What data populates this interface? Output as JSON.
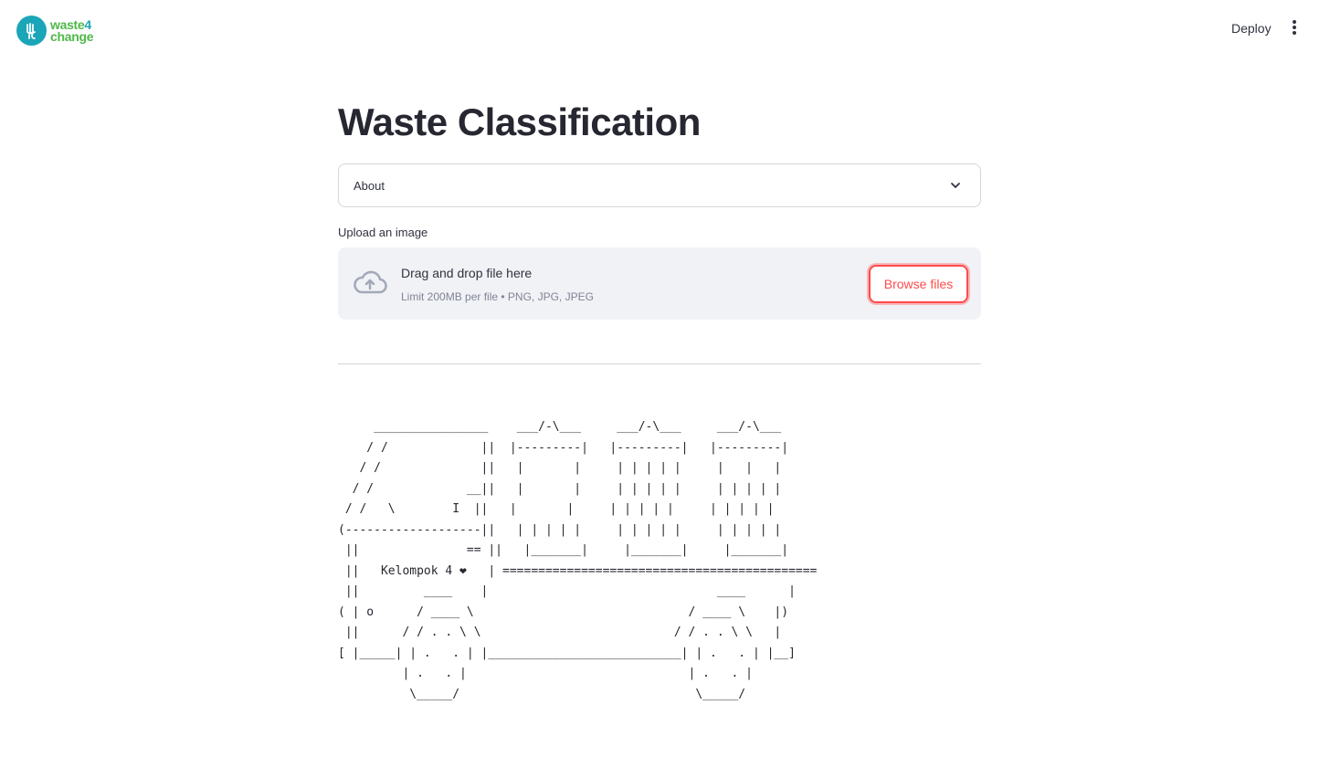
{
  "header": {
    "logo": {
      "line1": "waste",
      "line1_num": "4",
      "line2": "change"
    },
    "deploy_label": "Deploy",
    "menu_icon": "more-vertical-icon"
  },
  "main": {
    "title": "Waste Classification",
    "expander": {
      "label": "About",
      "icon": "chevron-down-icon"
    },
    "uploader": {
      "label": "Upload an image",
      "drop_title": "Drag and drop file here",
      "drop_subtitle": "Limit 200MB per file • PNG, JPG, JPEG",
      "browse_label": "Browse files",
      "icon": "cloud-upload-icon"
    },
    "ascii_art": "     ________________    ___/-\\___     ___/-\\___     ___/-\\___\n    / /             ||  |---------|   |---------|   |---------|\n   / /              ||   |       |     | | | | |     |   |   |\n  / /             __||   |       |     | | | | |     | | | | |\n / /   \\        I  ||   |       |     | | | | |     | | | | |\n(-------------------||   | | | | |     | | | | |     | | | | |\n ||               == ||   |_______|     |_______|     |_______|\n ||   Kelompok 4 ❤   | ============================================\n ||         ____    |                                ____      |\n( | o      / ____ \\                              / ____ \\    |)\n ||      / / . . \\ \\                           / / . . \\ \\   |\n[ |_____| | .   . | |___________________________| | .   . | |__]\n         | .   . |                               | .   . |\n          \\_____/                                 \\_____/",
    "colors": {
      "accent": "#ff4b4b",
      "dropzone_bg": "#f0f2f6",
      "logo_teal": "#1aa6b8",
      "logo_green": "#4fb848"
    }
  }
}
